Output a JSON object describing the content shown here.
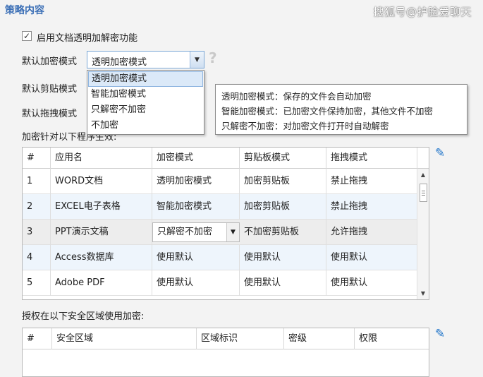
{
  "section_title": "策略内容",
  "watermark": "搜狐号@护脸爱聊天",
  "enable": {
    "checked": true,
    "mark": "✓",
    "label": "启用文档透明加解密功能"
  },
  "labels": {
    "default_mode": "默认加密模式",
    "default_clipboard": "默认剪贴模式",
    "default_drag": "默认拖拽模式",
    "programs": "加密针对以下程序生效:",
    "areas": "授权在以下安全区域使用加密:"
  },
  "mode_combo": {
    "value": "透明加密模式",
    "help": "?"
  },
  "dropdown": [
    "透明加密模式",
    "智能加密模式",
    "只解密不加密",
    "不加密"
  ],
  "tooltip": [
    "透明加密模式：保存的文件会自动加密",
    "智能加密模式：已加密文件保持加密，其他文件不加密",
    "只解密不加密：对加密文件打开时自动解密"
  ],
  "program_table": {
    "headers": [
      "#",
      "应用名",
      "加密模式",
      "剪贴板模式",
      "拖拽模式"
    ],
    "rows": [
      [
        "1",
        "WORD文档",
        "透明加密模式",
        "加密剪贴板",
        "禁止拖拽"
      ],
      [
        "2",
        "EXCEL电子表格",
        "智能加密模式",
        "加密剪贴板",
        "禁止拖拽"
      ],
      [
        "3",
        "PPT演示文稿",
        "只解密不加密",
        "不加密剪贴板",
        "允许拖拽"
      ],
      [
        "4",
        "Access数据库",
        "使用默认",
        "使用默认",
        "使用默认"
      ],
      [
        "5",
        "Adobe PDF",
        "使用默认",
        "使用默认",
        "使用默认"
      ]
    ]
  },
  "area_table": {
    "headers": [
      "#",
      "安全区域",
      "区域标识",
      "密级",
      "权限"
    ]
  },
  "icons": {
    "edit": "pencil-icon",
    "accent": "#1f74c9",
    "title_color": "#3b6fb6"
  }
}
